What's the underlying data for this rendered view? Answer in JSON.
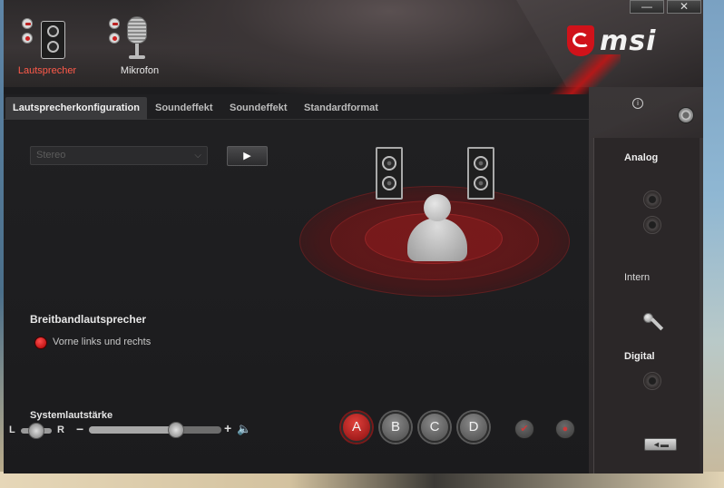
{
  "window": {
    "minimize_label": "—",
    "close_label": "✕"
  },
  "header": {
    "devices": [
      {
        "label": "Lautsprecher",
        "icon": "speaker-icon",
        "active": true
      },
      {
        "label": "Mikrofon",
        "icon": "microphone-icon",
        "active": false
      }
    ],
    "logo_text": "msi",
    "accent_color": "#d0121a"
  },
  "tabs": [
    {
      "label": "Lautsprecherkonfiguration",
      "active": true
    },
    {
      "label": "Soundeffekt",
      "active": false
    },
    {
      "label": "Soundeffekt",
      "active": false
    },
    {
      "label": "Standardformat",
      "active": false
    }
  ],
  "config": {
    "speaker_mode_value": "Stereo",
    "play_label": "▶"
  },
  "wideband": {
    "title": "Breitbandlautsprecher",
    "item_label": "Vorne links und rechts"
  },
  "volume": {
    "title": "Systemlautstärke",
    "left_label": "L",
    "right_label": "R",
    "minus_label": "−",
    "plus_label": "+",
    "level_percent": 66,
    "balance_percent": 50
  },
  "profiles": [
    {
      "label": "A",
      "active": true
    },
    {
      "label": "B",
      "active": false
    },
    {
      "label": "C",
      "active": false
    },
    {
      "label": "D",
      "active": false
    }
  ],
  "side": {
    "analog_label": "Analog",
    "intern_label": "Intern",
    "digital_label": "Digital",
    "info_label": "i"
  }
}
